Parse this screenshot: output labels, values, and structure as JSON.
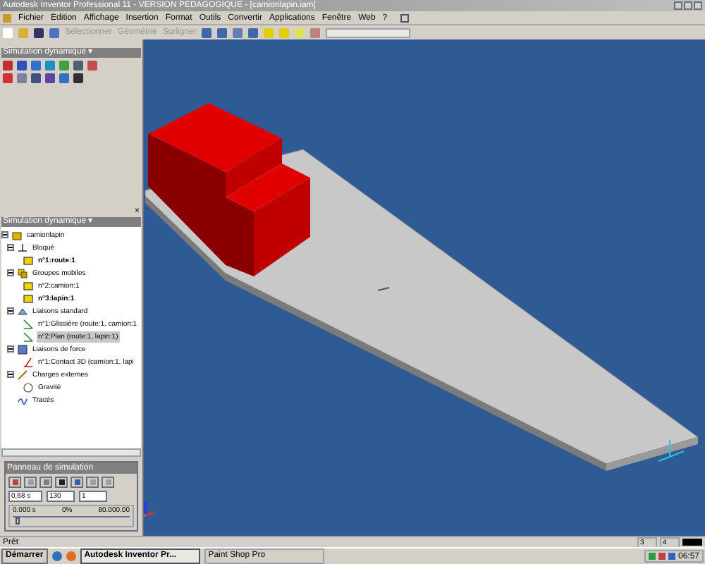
{
  "window": {
    "title": "Autodesk Inventor Professional 11 - VERSION PEDAGOGIQUE - [camionlapin.iam]"
  },
  "menu": [
    "Fichier",
    "Edition",
    "Affichage",
    "Insertion",
    "Format",
    "Outils",
    "Convertir",
    "Applications",
    "Fenêtre",
    "Web",
    "?"
  ],
  "toolbar": {
    "dropdowns": [
      {
        "label": "Sélectionner",
        "disabled": true
      },
      {
        "label": "Géométrie",
        "disabled": true
      },
      {
        "label": "Surligner",
        "disabled": true
      }
    ]
  },
  "tool_panel": {
    "title": "Simulation dynamique ▾"
  },
  "browser": {
    "close": "×",
    "title": "Simulation dynamique ▾",
    "tree": [
      {
        "label": "camionlapin",
        "kind": "assembly",
        "expanded": true,
        "selected": false,
        "children": [
          {
            "label": "Bloqué",
            "kind": "fixed",
            "expanded": true,
            "selected": false,
            "children": [
              {
                "label": "n°1:route:1",
                "kind": "part",
                "selected": false,
                "bold": true
              }
            ]
          },
          {
            "label": "Groupes mobiles",
            "kind": "groups",
            "expanded": true,
            "selected": false,
            "children": [
              {
                "label": "n°2:camion:1",
                "kind": "part",
                "selected": false,
                "bold": false
              },
              {
                "label": "n°3:lapin:1",
                "kind": "part",
                "selected": false,
                "bold": true
              }
            ]
          },
          {
            "label": "Liaisons standard",
            "kind": "joints",
            "expanded": true,
            "selected": false,
            "children": [
              {
                "label": "n°1:Glissière (route:1, camion:1",
                "kind": "joint",
                "selected": false,
                "bold": false
              },
              {
                "label": "n°2:Plan (route:1, lapin:1)",
                "kind": "joint",
                "selected": true,
                "bold": false
              }
            ]
          },
          {
            "label": "Liaisons de force",
            "kind": "force",
            "expanded": true,
            "selected": false,
            "children": [
              {
                "label": "n°1:Contact 3D (camion:1, lapi",
                "kind": "contact",
                "selected": false,
                "bold": false
              }
            ]
          },
          {
            "label": "Charges externes",
            "kind": "loads",
            "expanded": true,
            "selected": false,
            "children": [
              {
                "label": "Gravité",
                "kind": "gravity",
                "selected": false,
                "bold": false
              }
            ]
          },
          {
            "label": "Tracés",
            "kind": "traces",
            "selected": false
          }
        ]
      }
    ]
  },
  "simulation_panel": {
    "title": "Panneau de simulation",
    "final_time": "0,68 s",
    "images": "130",
    "filter": "1",
    "current_time": "0.000 s",
    "percent": "0%",
    "elapsed": "80.000.00",
    "level": 0.03
  },
  "status_bar": {
    "text": "Prêt",
    "values": [
      "3",
      "4"
    ]
  },
  "taskbar": {
    "start": "Démarrer",
    "tasks": [
      {
        "label": "Autodesk Inventor Pr...",
        "selected": true
      },
      {
        "label": "Paint Shop Pro",
        "selected": false
      }
    ],
    "clock": "06:57"
  }
}
